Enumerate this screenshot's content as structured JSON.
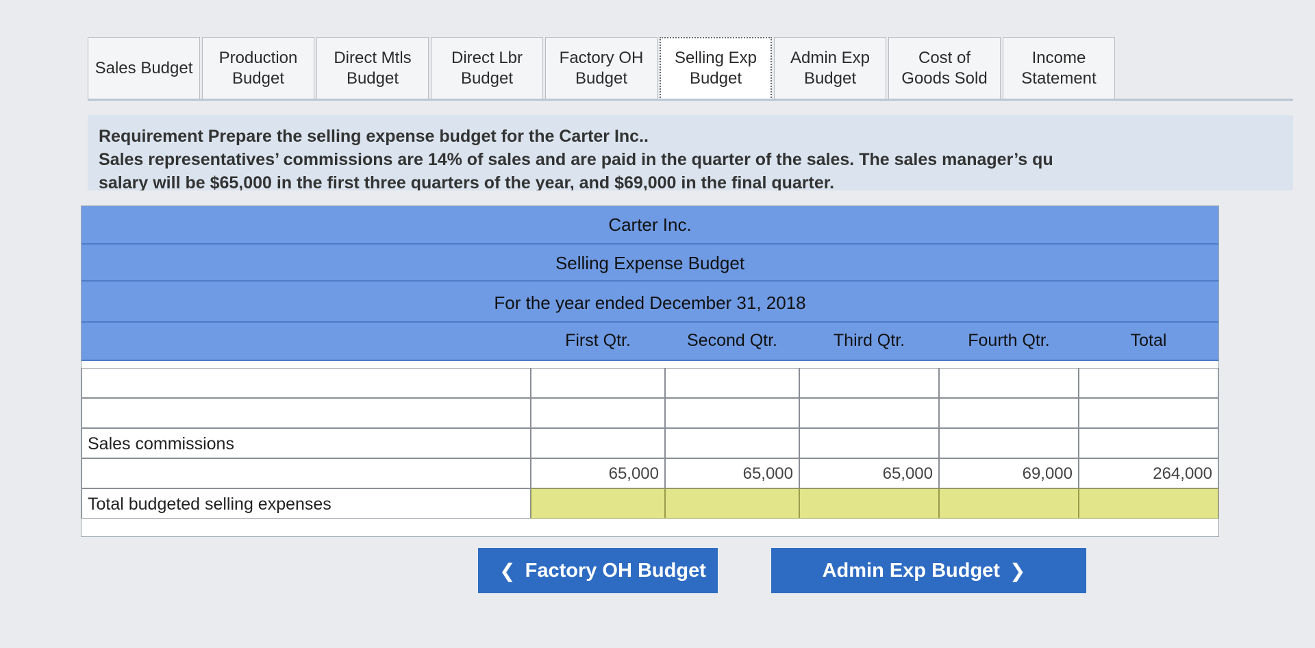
{
  "tabs": [
    {
      "line1": "Sales Budget",
      "line2": "",
      "active": false
    },
    {
      "line1": "Production",
      "line2": "Budget",
      "active": false
    },
    {
      "line1": "Direct Mtls",
      "line2": "Budget",
      "active": false
    },
    {
      "line1": "Direct Lbr",
      "line2": "Budget",
      "active": false
    },
    {
      "line1": "Factory OH",
      "line2": "Budget",
      "active": false
    },
    {
      "line1": "Selling Exp",
      "line2": "Budget",
      "active": true
    },
    {
      "line1": "Admin Exp",
      "line2": "Budget",
      "active": false
    },
    {
      "line1": "Cost of",
      "line2": "Goods Sold",
      "active": false
    },
    {
      "line1": "Income",
      "line2": "Statement",
      "active": false
    }
  ],
  "requirement": {
    "line1": "Requirement Prepare the selling expense budget for the Carter Inc..",
    "line2": "Sales representatives’ commissions are 14% of sales and are paid in the quarter of the sales. The sales manager’s qu",
    "line3": "salary will be $65,000 in the first three quarters of the year, and $69,000 in the final quarter."
  },
  "budget": {
    "company": "Carter Inc.",
    "title": "Selling Expense Budget",
    "period": "For the year ended December 31, 2018",
    "columns": [
      "First Qtr.",
      "Second Qtr.",
      "Third Qtr.",
      "Fourth Qtr.",
      "Total"
    ],
    "rows": [
      {
        "label": "",
        "values": [
          "",
          "",
          "",
          "",
          ""
        ]
      },
      {
        "label": "",
        "values": [
          "",
          "",
          "",
          "",
          ""
        ]
      },
      {
        "label": "Sales commissions",
        "values": [
          "",
          "",
          "",
          "",
          ""
        ]
      },
      {
        "label": "",
        "values": [
          "65,000",
          "65,000",
          "65,000",
          "69,000",
          "264,000"
        ]
      },
      {
        "label": "Total budgeted selling expenses",
        "values": [
          "",
          "",
          "",
          "",
          ""
        ]
      }
    ]
  },
  "nav": {
    "prev_label": "Factory OH Budget",
    "next_label": "Admin Exp Budget",
    "prev_icon": "chevron-left-icon",
    "next_icon": "chevron-right-icon"
  },
  "colors": {
    "header_blue": "#6f9be4",
    "button_blue": "#2e6cc3",
    "total_yellow": "#e3e58a"
  }
}
